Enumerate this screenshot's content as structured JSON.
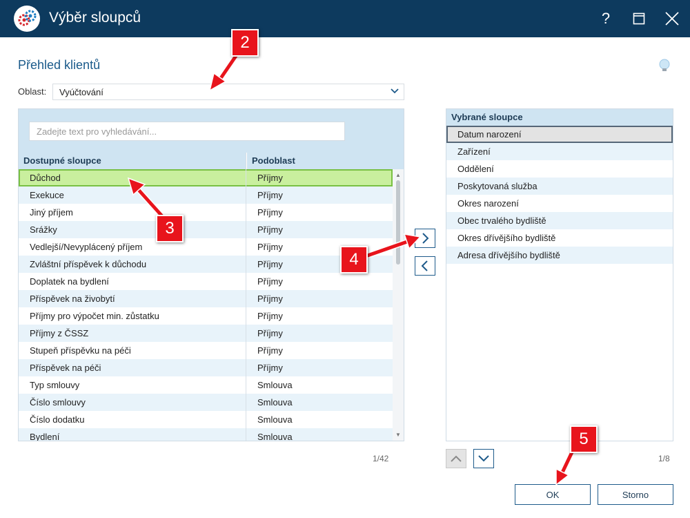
{
  "window": {
    "title": "Výběr sloupců",
    "help_label": "?"
  },
  "page": {
    "title": "Přehled klientů"
  },
  "area": {
    "label": "Oblast:",
    "value": "Vyúčtování"
  },
  "search": {
    "placeholder": "Zadejte text pro vyhledávání..."
  },
  "available": {
    "header_name": "Dostupné sloupce",
    "header_sub": "Podoblast",
    "count": "1/42",
    "rows": [
      {
        "name": "Důchod",
        "sub": "Příjmy"
      },
      {
        "name": "Exekuce",
        "sub": "Příjmy"
      },
      {
        "name": "Jiný příjem",
        "sub": "Příjmy"
      },
      {
        "name": "Srážky",
        "sub": "Příjmy"
      },
      {
        "name": "Vedlejší/Nevyplácený příjem",
        "sub": "Příjmy"
      },
      {
        "name": "Zvláštní příspěvek k důchodu",
        "sub": "Příjmy"
      },
      {
        "name": "Doplatek na bydlení",
        "sub": "Příjmy"
      },
      {
        "name": "Příspěvek na živobytí",
        "sub": "Příjmy"
      },
      {
        "name": "Příjmy pro výpočet min. zůstatku",
        "sub": "Příjmy"
      },
      {
        "name": "Příjmy z ČSSZ",
        "sub": "Příjmy"
      },
      {
        "name": "Stupeň příspěvku na péči",
        "sub": "Příjmy"
      },
      {
        "name": "Příspěvek na péči",
        "sub": "Příjmy"
      },
      {
        "name": "Typ smlouvy",
        "sub": "Smlouva"
      },
      {
        "name": "Číslo smlouvy",
        "sub": "Smlouva"
      },
      {
        "name": "Číslo dodatku",
        "sub": "Smlouva"
      },
      {
        "name": "Bydlení",
        "sub": "Smlouva"
      }
    ]
  },
  "selected": {
    "header": "Vybrané sloupce",
    "count": "1/8",
    "rows": [
      "Datum narození",
      "Zařízení",
      "Oddělení",
      "Poskytovaná služba",
      "Okres narození",
      "Obec trvalého bydliště",
      "Okres dřívějšího bydliště",
      "Adresa dřívějšího bydliště"
    ]
  },
  "buttons": {
    "ok": "OK",
    "cancel": "Storno"
  },
  "annotations": {
    "step2": "2",
    "step3": "3",
    "step4": "4",
    "step5": "5"
  },
  "colors": {
    "titlebar": "#0d3a5e",
    "accent": "#1d5a8a",
    "selected_row": "#c9ef9e",
    "annotation": "#e8141c"
  },
  "icons": {
    "app": "gears-icon",
    "hint": "lightbulb-icon",
    "maximize": "maximize-icon",
    "close": "close-icon"
  }
}
